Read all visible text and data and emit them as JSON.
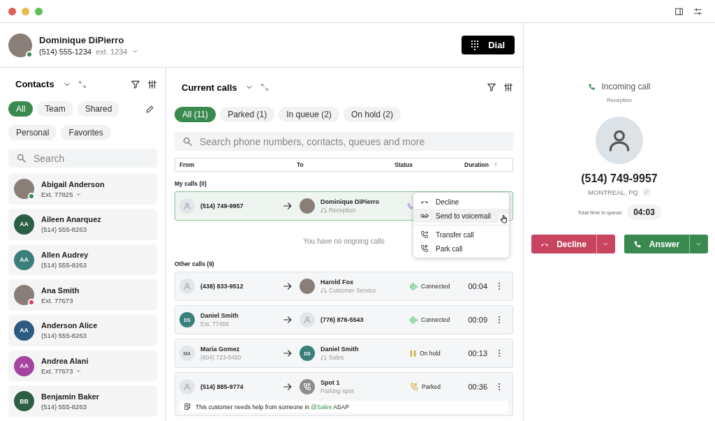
{
  "user": {
    "name": "Dominique DiPierro",
    "phone": "(514) 555-1234",
    "ext": "ext. 1234",
    "color": "#3a8a4f"
  },
  "dial_button": {
    "label": "Dial"
  },
  "contacts": {
    "title": "Contacts",
    "filters": [
      {
        "label": "All",
        "selected": true
      },
      {
        "label": "Team",
        "selected": false
      },
      {
        "label": "Shared",
        "selected": false
      },
      {
        "label": "Personal",
        "selected": false
      },
      {
        "label": "Favorites",
        "selected": false
      }
    ],
    "search": {
      "placeholder": "Search"
    },
    "items": [
      {
        "name": "Abigail Anderson",
        "detail": "Ext. 77825",
        "kind": "photo",
        "color": "#3a8a4f",
        "dropdown": true
      },
      {
        "name": "Aileen Anarquez",
        "detail": "(514) 555-8263",
        "kind": "initials",
        "initials": "AA",
        "color": "#2c5e44",
        "dropdown": false
      },
      {
        "name": "Allen Audrey",
        "detail": "(514) 555-8263",
        "kind": "initials",
        "initials": "AA",
        "color": "#3a7f7c",
        "dropdown": false
      },
      {
        "name": "Ana Smith",
        "detail": "Ext. 77673",
        "kind": "photo",
        "color": "#d2435e",
        "dropdown": false
      },
      {
        "name": "Anderson Alice",
        "detail": "(514) 555-8263",
        "kind": "initials",
        "initials": "AA",
        "color": "#2d5a80",
        "dropdown": false
      },
      {
        "name": "Andrea Alani",
        "detail": "Ext. 77673",
        "kind": "initials",
        "initials": "AA",
        "color": "#a4449e",
        "dropdown": true
      },
      {
        "name": "Benjamin Baker",
        "detail": "(514) 555-8263",
        "kind": "initials",
        "initials": "BB",
        "color": "#2c5e44",
        "dropdown": false
      }
    ]
  },
  "calls": {
    "title": "Current calls",
    "filters": [
      {
        "label": "All (11)",
        "selected": true
      },
      {
        "label": "Parked (1)",
        "selected": false
      },
      {
        "label": "In queue (2)",
        "selected": false
      },
      {
        "label": "On hold (2)",
        "selected": false
      }
    ],
    "search": {
      "placeholder": "Search phone numbers, contacts, queues and more"
    },
    "columns": [
      "From",
      "To",
      "Status",
      "Duration"
    ],
    "my_calls_heading": "My calls (0)",
    "my_calls": [
      {
        "from": {
          "name": "(514) 749-9957",
          "kind": "unknown"
        },
        "to": {
          "name": "Dominique DiPierro",
          "sub": "Reception",
          "headset": true,
          "kind": "photo"
        },
        "status": {
          "kind": "ringing"
        },
        "selected": true
      }
    ],
    "empty_message": "You have no ongoing calls",
    "menu": [
      [
        {
          "label": "Decline",
          "kind": "hangup",
          "hovered": false
        },
        {
          "label": "Send to voicemail",
          "kind": "voicemail",
          "hovered": true
        }
      ],
      [
        {
          "label": "Transfer call",
          "kind": "transfer",
          "hovered": false
        },
        {
          "label": "Park call",
          "kind": "park",
          "hovered": false
        }
      ]
    ],
    "other_calls_heading": "Other calls (9)",
    "other_calls": [
      {
        "from": {
          "name": "(438) 833-9512",
          "kind": "unknown"
        },
        "to": {
          "name": "Harold Fox",
          "sub": "Customer Service",
          "headset": true,
          "kind": "photo"
        },
        "status": {
          "kind": "connected",
          "label": "Connected"
        },
        "duration": "00:04",
        "selected": false
      },
      {
        "from": {
          "name": "Daniel Smith",
          "sub": "Ext. 77458",
          "headset": false,
          "kind": "initials",
          "initials": "DS",
          "color": "#3a7f7c"
        },
        "to": {
          "name": "(776) 876-5543",
          "kind": "unknown"
        },
        "status": {
          "kind": "connected",
          "label": "Connected"
        },
        "duration": "00:09",
        "selected": false
      },
      {
        "from": {
          "name": "Maria Gomez",
          "sub": "(604) 723-0450",
          "headset": false,
          "kind": "initials",
          "initials": "MA",
          "color": "#e2e6ea"
        },
        "to": {
          "name": "Daniel Smith",
          "sub": "Sales",
          "headset": true,
          "kind": "initials",
          "initials": "DS",
          "color": "#3a7f7c"
        },
        "status": {
          "kind": "on_hold",
          "label": "On hold"
        },
        "duration": "00:13",
        "selected": false
      },
      {
        "from": {
          "name": "(514) 885-9774",
          "kind": "unknown"
        },
        "to": {
          "name": "Spot 1",
          "sub": "Parking spot",
          "headset": false,
          "kind": "parking"
        },
        "status": {
          "kind": "parked",
          "label": "Parked"
        },
        "duration": "00:36",
        "selected": false,
        "note": [
          {
            "kind": "text",
            "text": "This customer needs help from someone in "
          },
          {
            "kind": "mention",
            "text": "@Sales"
          },
          {
            "kind": "text",
            "text": " ASAP"
          }
        ]
      }
    ]
  },
  "incoming": {
    "label": "Incoming call",
    "queue": "Reception",
    "number": "(514) 749-9957",
    "location": "MONTREAL, PQ",
    "queue_time_label": "Total time in queue:",
    "queue_time": "04:03",
    "decline": "Decline",
    "answer": "Answer"
  }
}
